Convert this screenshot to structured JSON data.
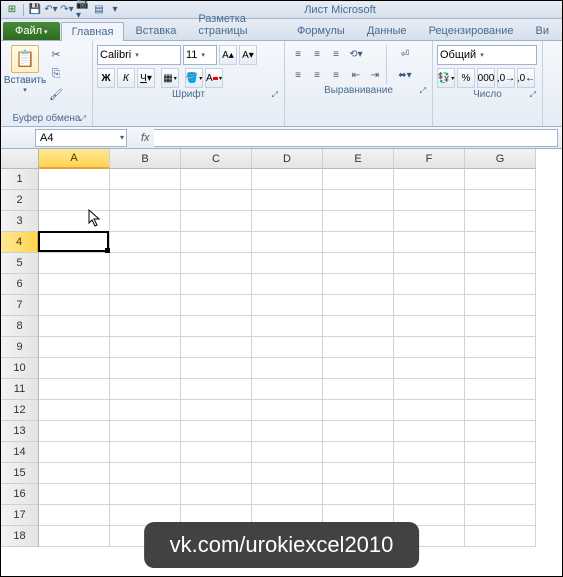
{
  "title": "Лист Microsoft",
  "tabs": {
    "file": "Файл",
    "home": "Главная",
    "insert": "Вставка",
    "pagelayout": "Разметка страницы",
    "formulas": "Формулы",
    "data": "Данные",
    "review": "Рецензирование",
    "view": "Ви"
  },
  "clipboard": {
    "paste": "Вставить",
    "label": "Буфер обмена"
  },
  "font": {
    "name": "Calibri",
    "size": "11",
    "label": "Шрифт"
  },
  "alignment": {
    "label": "Выравнивание"
  },
  "number": {
    "format": "Общий",
    "label": "Число"
  },
  "namebox": "A4",
  "formula": "",
  "columns": [
    "A",
    "B",
    "C",
    "D",
    "E",
    "F",
    "G"
  ],
  "rows": [
    "1",
    "2",
    "3",
    "4",
    "5",
    "6",
    "7",
    "8",
    "9",
    "10",
    "11",
    "12",
    "13",
    "14",
    "15",
    "16",
    "17",
    "18"
  ],
  "active": {
    "col": 0,
    "row": 3
  },
  "watermark": "vk.com/urokiexcel2010"
}
